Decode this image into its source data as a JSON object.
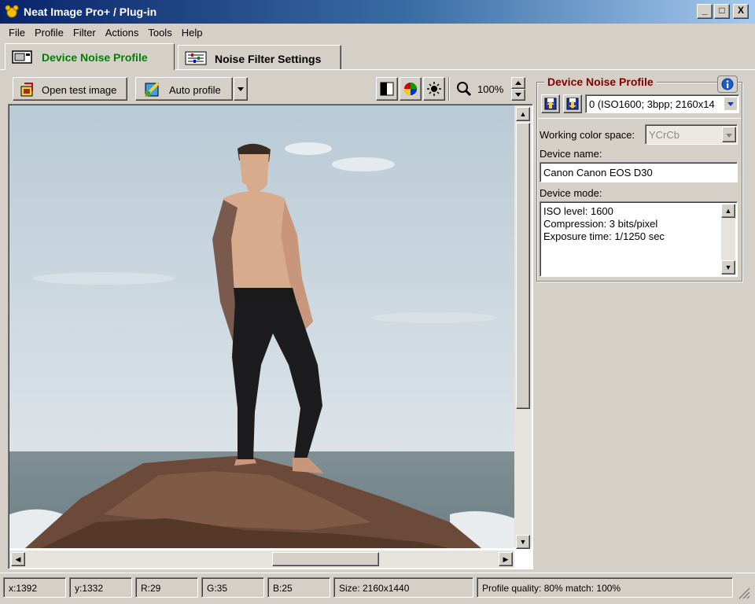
{
  "window": {
    "title": "Neat Image Pro+ / Plug-in",
    "controls": [
      "_",
      "□",
      "X"
    ]
  },
  "menu": [
    "File",
    "Profile",
    "Filter",
    "Actions",
    "Tools",
    "Help"
  ],
  "tabs": [
    {
      "label": "Device Noise Profile",
      "active": true
    },
    {
      "label": "Noise Filter Settings",
      "active": false
    }
  ],
  "toolbar": {
    "open_test_image": "Open test image",
    "auto_profile": "Auto profile",
    "zoom": "100%"
  },
  "panel": {
    "title": "Device Noise Profile",
    "profile_select": "0 (ISO1600; 3bpp; 2160x14",
    "working_color_space_label": "Working color space:",
    "working_color_space_value": "YCrCb",
    "device_name_label": "Device name:",
    "device_name_value": "Canon Canon EOS D30",
    "device_mode_label": "Device mode:",
    "device_mode_lines": [
      "ISO level: 1600",
      "Compression: 3 bits/pixel",
      "Exposure time: 1/1250 sec"
    ]
  },
  "status": {
    "x": "x:1392",
    "y": "y:1332",
    "r": "R:29",
    "g": "G:35",
    "b": "B:25",
    "size": "Size: 2160x1440",
    "quality": "Profile quality: 80%  match: 100%"
  },
  "colors": {
    "accent_green": "#008000",
    "panel_title_red": "#800000",
    "title_bar": "#0a246a"
  }
}
